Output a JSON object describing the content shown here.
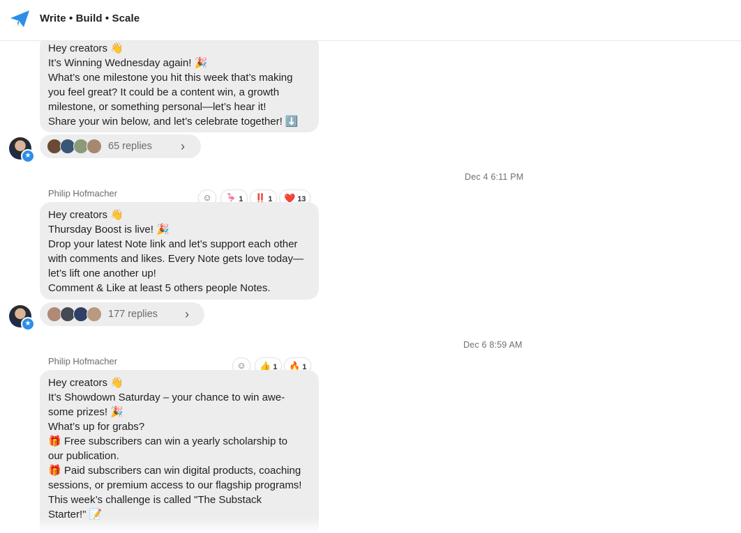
{
  "header": {
    "title": "Write • Build • Scale",
    "logo_icon": "paper-plane-icon",
    "accent": "#2b8fe8"
  },
  "messages": [
    {
      "lines": [
        "Hey creators 👋",
        "It’s Winning Wednesday again! 🎉",
        "What’s one milestone you hit this week that’s making",
        "you feel great? It could be a content win, a growth",
        "milestone, or something personal—let’s hear it!",
        "Share your win below, and let’s celebrate together! ⬇️"
      ],
      "replies": "65 replies"
    },
    {
      "timestamp": "Dec 4 6:11 PM",
      "sender": "Philip Hofmacher",
      "reactions": [
        {
          "emoji": "🦩",
          "count": "1"
        },
        {
          "emoji": "‼️",
          "count": "1"
        },
        {
          "emoji": "❤️",
          "count": "13"
        }
      ],
      "lines": [
        "Hey creators 👋",
        "Thursday Boost is live! 🎉",
        "Drop your latest Note link and let’s support each other",
        "with comments and likes. Every Note gets love today—",
        "let’s lift one another up!",
        "Comment & Like at least 5 others people Notes."
      ],
      "replies": "177 replies"
    },
    {
      "timestamp": "Dec 6 8:59 AM",
      "sender": "Philip Hofmacher",
      "reactions": [
        {
          "emoji": "👍",
          "count": "1"
        },
        {
          "emoji": "🔥",
          "count": "1"
        }
      ],
      "lines": [
        "Hey creators 👋",
        "It’s Showdown Saturday – your chance to win awe-",
        "some prizes! 🎉",
        "What’s up for grabs?",
        "🎁 Free subscribers can win a yearly scholarship to",
        "our publication.",
        "🎁 Paid subscribers can win digital products, coaching",
        "sessions, or premium access to our flagship programs!",
        "This week’s challenge is called \"The Substack",
        "Starter!\" 📝"
      ]
    }
  ]
}
